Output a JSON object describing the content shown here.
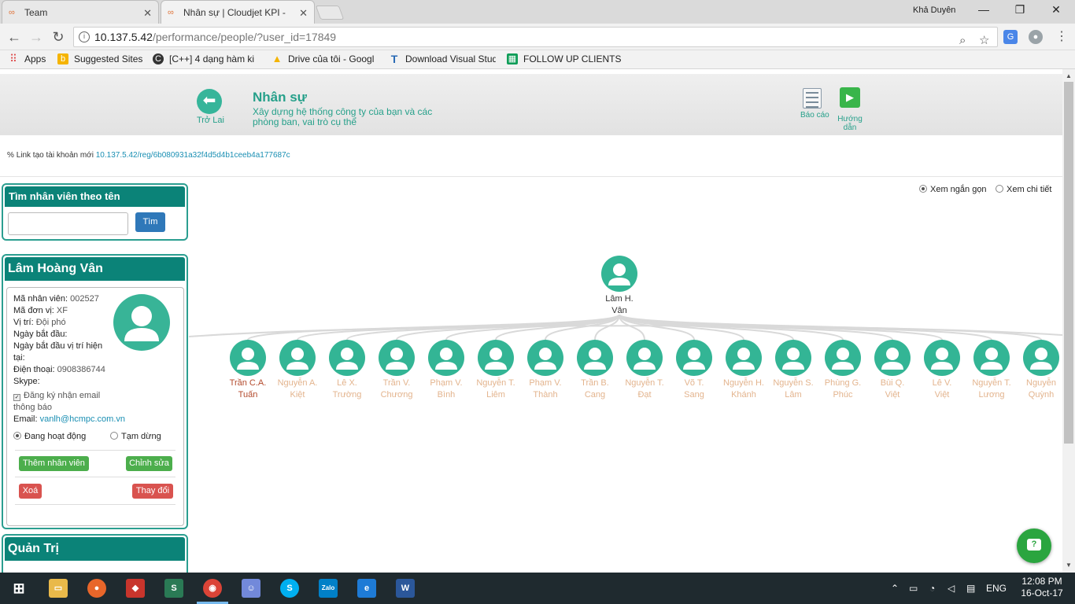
{
  "browser": {
    "tabs": [
      {
        "title": "Team",
        "active": false
      },
      {
        "title": "Nhân sự | Cloudjet KPI - ",
        "active": true
      }
    ],
    "user": "Khả Duyên",
    "url_host": "10.137.5.42",
    "url_path": "/performance/people/?user_id=17849",
    "bookmarks": [
      {
        "label": "Apps",
        "icon": "apps-grid-icon"
      },
      {
        "label": "Suggested Sites",
        "icon": "bing-icon"
      },
      {
        "label": "[C++] 4 dạng hàm ki",
        "icon": "cpp-site-icon"
      },
      {
        "label": "Drive của tôi - Googl",
        "icon": "google-drive-icon"
      },
      {
        "label": "Download Visual Stud",
        "icon": "visual-studio-icon"
      },
      {
        "label": "FOLLOW UP CLIENTS",
        "icon": "sheets-icon"
      }
    ]
  },
  "header": {
    "back_label": "Trở Lai",
    "title": "Nhân sự",
    "subtitle": "Xây dựng hệ thống công ty của bạn và các phòng ban, vai trò cụ thể",
    "report_label": "Báo cáo",
    "guide_label": "Hướng dẫn"
  },
  "reg_link": {
    "label": "Link tạo tài khoản mới",
    "url": "10.137.5.42/reg/6b080931a32f4d5d4b1ceeb4a177687c"
  },
  "search": {
    "title": "Tìm nhân viên theo tên",
    "input_value": "",
    "button": "Tìm"
  },
  "profile": {
    "name": "Lâm Hoàng Vân",
    "emp_code_label": "Mã nhân viên:",
    "emp_code": "002527",
    "unit_label": "Mã đơn vị:",
    "unit": "XF",
    "position_label": "Vị trí:",
    "position": "Đội phó",
    "start_label": "Ngày bắt đầu:",
    "start_pos_label_1": "Ngày bắt đầu vị trí hiện",
    "start_pos_label_2": "tại:",
    "phone_label": "Điện thoại:",
    "phone": "0908386744",
    "skype_label": "Skype:",
    "email_notify_1": "Đăng ký nhận email",
    "email_notify_2": "thông báo",
    "email_label": "Email:",
    "email": "vanlh@hcmpc.com.vn",
    "status_active": "Đang hoạt động",
    "status_paused": "Tạm dừng",
    "add_btn": "Thêm nhân viên",
    "edit_btn": "Chỉnh sửa",
    "delete_btn": "Xoá",
    "change_btn": "Thay đổi"
  },
  "admin": {
    "title": "Quản Trị"
  },
  "view_options": {
    "compact": "Xem ngắn gọn",
    "detailed": "Xem chi tiết",
    "selected": "compact"
  },
  "org": {
    "root": {
      "line1": "Lâm H.",
      "line2": "Vân"
    },
    "children": [
      {
        "line1": "Trần C.A.",
        "line2": "Tuấn"
      },
      {
        "line1": "Nguyễn A.",
        "line2": "Kiệt"
      },
      {
        "line1": "Lê X.",
        "line2": "Trường"
      },
      {
        "line1": "Trần V.",
        "line2": "Chương"
      },
      {
        "line1": "Phạm V.",
        "line2": "Bình"
      },
      {
        "line1": "Nguyễn T.",
        "line2": "Liêm"
      },
      {
        "line1": "Phạm V.",
        "line2": "Thành"
      },
      {
        "line1": "Trần B.",
        "line2": "Cang"
      },
      {
        "line1": "Nguyễn T.",
        "line2": "Đạt"
      },
      {
        "line1": "Võ T.",
        "line2": "Sang"
      },
      {
        "line1": "Nguyễn H.",
        "line2": "Khánh"
      },
      {
        "line1": "Nguyễn S.",
        "line2": "Lâm"
      },
      {
        "line1": "Phùng G.",
        "line2": "Phúc"
      },
      {
        "line1": "Bùi Q.",
        "line2": "Việt"
      },
      {
        "line1": "Lê V.",
        "line2": "Việt"
      },
      {
        "line1": "Nguyễn T.",
        "line2": "Lương"
      },
      {
        "line1": "Nguyễn",
        "line2": "Quỳnh"
      }
    ]
  },
  "taskbar": {
    "lang": "ENG",
    "time": "12:08 PM",
    "date": "16-Oct-17"
  },
  "colors": {
    "brand": "#26a08a",
    "avatar": "#33b595",
    "panel_head": "#0b8378"
  }
}
